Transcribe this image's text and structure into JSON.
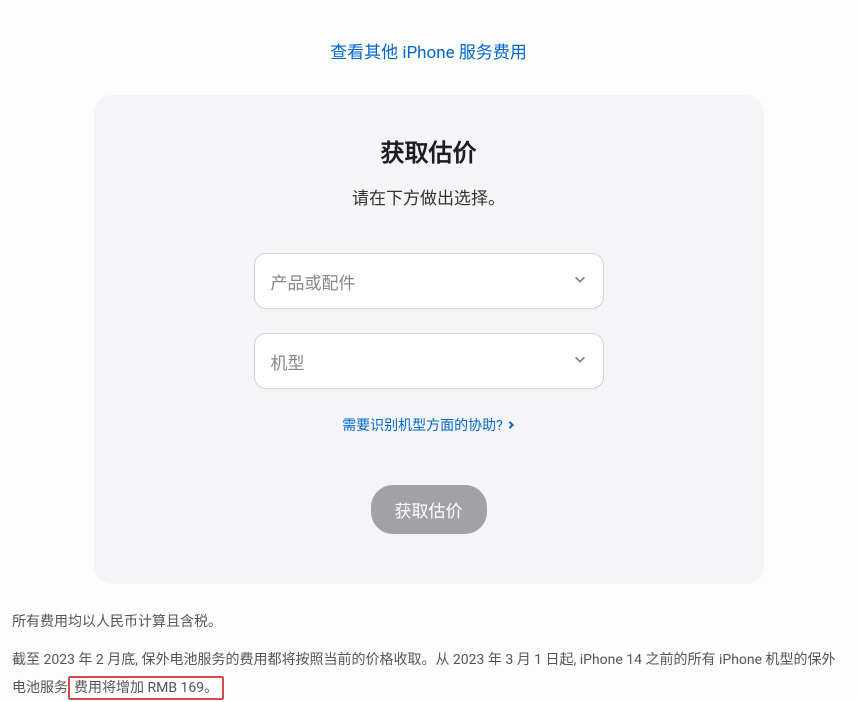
{
  "top_link": "查看其他 iPhone 服务费用",
  "card": {
    "title": "获取估价",
    "subtitle": "请在下方做出选择。",
    "select_product_placeholder": "产品或配件",
    "select_model_placeholder": "机型",
    "help_link": "需要识别机型方面的协助?",
    "submit_button": "获取估价"
  },
  "footer": {
    "line1": "所有费用均以人民币计算且含税。",
    "line2_before": "截至 2023 年 2 月底, 保外电池服务的费用都将按照当前的价格收取。从 2023 年 3 月 1 日起, iPhone 14 之前的所有 iPhone 机型的保外电池服务",
    "line2_highlight": "费用将增加 RMB 169。"
  }
}
